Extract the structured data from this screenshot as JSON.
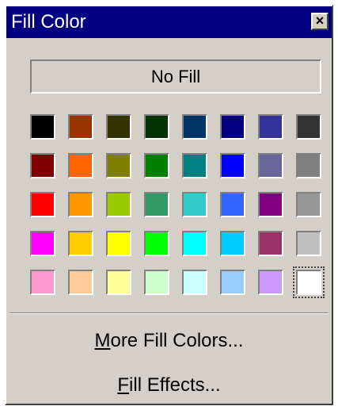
{
  "window": {
    "title": "Fill Color"
  },
  "close_glyph": "×",
  "no_fill_label": "No Fill",
  "palette": {
    "rows": [
      [
        "#000000",
        "#993300",
        "#333300",
        "#003300",
        "#003366",
        "#000080",
        "#333399",
        "#333333"
      ],
      [
        "#800000",
        "#FF6600",
        "#808000",
        "#008000",
        "#008080",
        "#0000FF",
        "#666699",
        "#808080"
      ],
      [
        "#FF0000",
        "#FF9900",
        "#99CC00",
        "#339966",
        "#33CCCC",
        "#3366FF",
        "#800080",
        "#969696"
      ],
      [
        "#FF00FF",
        "#FFCC00",
        "#FFFF00",
        "#00FF00",
        "#00FFFF",
        "#00CCFF",
        "#993366",
        "#C0C0C0"
      ],
      [
        "#FF99CC",
        "#FFCC99",
        "#FFFF99",
        "#CCFFCC",
        "#CCFFFF",
        "#99CCFF",
        "#CC99FF",
        "#FFFFFF"
      ]
    ],
    "selected": "#FFFFFF"
  },
  "menu": {
    "more_colors": {
      "accel": "M",
      "rest": "ore Fill Colors..."
    },
    "fill_effects": {
      "accel": "F",
      "rest": "ill Effects..."
    }
  }
}
